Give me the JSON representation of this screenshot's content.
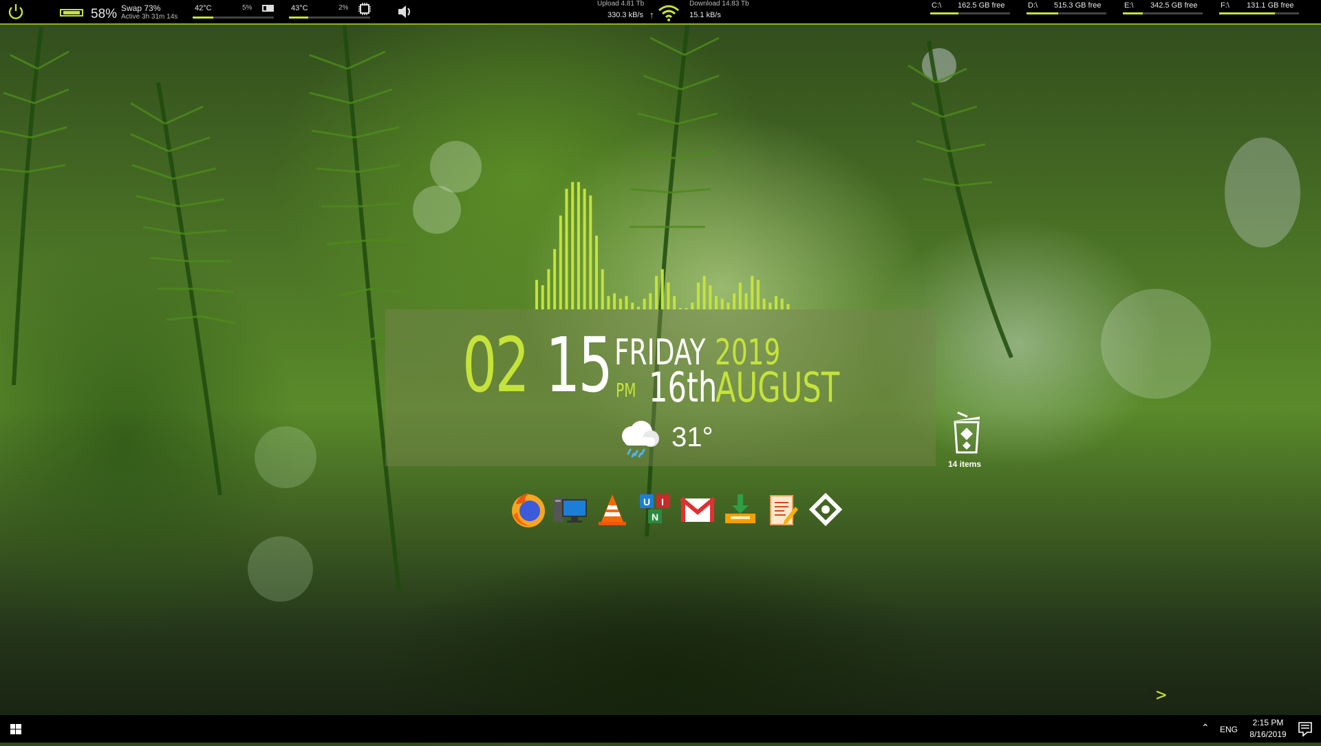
{
  "topbar": {
    "memory": {
      "percent": "58%",
      "swap": "Swap 73%",
      "active": "Active 3h 31m 14s"
    },
    "gpu": {
      "temp": "42°C",
      "usage": "5%"
    },
    "cpu": {
      "temp": "43°C",
      "usage": "2%"
    },
    "network": {
      "upload_total": "Upload 4.81 Tb",
      "upload_rate": "330.3 kB/s",
      "download_total": "Download 14.83 Tb",
      "download_rate": "15.1 kB/s"
    },
    "drives": [
      {
        "label": "C:\\",
        "free": "162.5 GB free",
        "fill": 0.35
      },
      {
        "label": "D:\\",
        "free": "515.3 GB free",
        "fill": 0.4
      },
      {
        "label": "E:\\",
        "free": "342.5 GB free",
        "fill": 0.25
      },
      {
        "label": "F:\\",
        "free": "131.1 GB free",
        "fill": 0.7
      }
    ]
  },
  "clock": {
    "hour": "02",
    "minute": "15",
    "ampm": "PM",
    "day": "FRIDAY",
    "year": "2019",
    "date": "16th",
    "month": "AUGUST"
  },
  "weather": {
    "temp": "31°",
    "icon": "rain-cloud-icon"
  },
  "recycle_bin": {
    "count": "14 items"
  },
  "dock": [
    {
      "name": "firefox-icon"
    },
    {
      "name": "this-pc-icon"
    },
    {
      "name": "vlc-icon"
    },
    {
      "name": "uni-icon"
    },
    {
      "name": "gmail-icon"
    },
    {
      "name": "download-manager-icon"
    },
    {
      "name": "notepad-icon"
    },
    {
      "name": "gitkraken-icon"
    }
  ],
  "terminal": {
    "prompt": ">"
  },
  "taskbar": {
    "language": "ENG",
    "time": "2:15 PM",
    "date": "8/16/2019"
  },
  "colors": {
    "accent": "#c5e33a"
  }
}
